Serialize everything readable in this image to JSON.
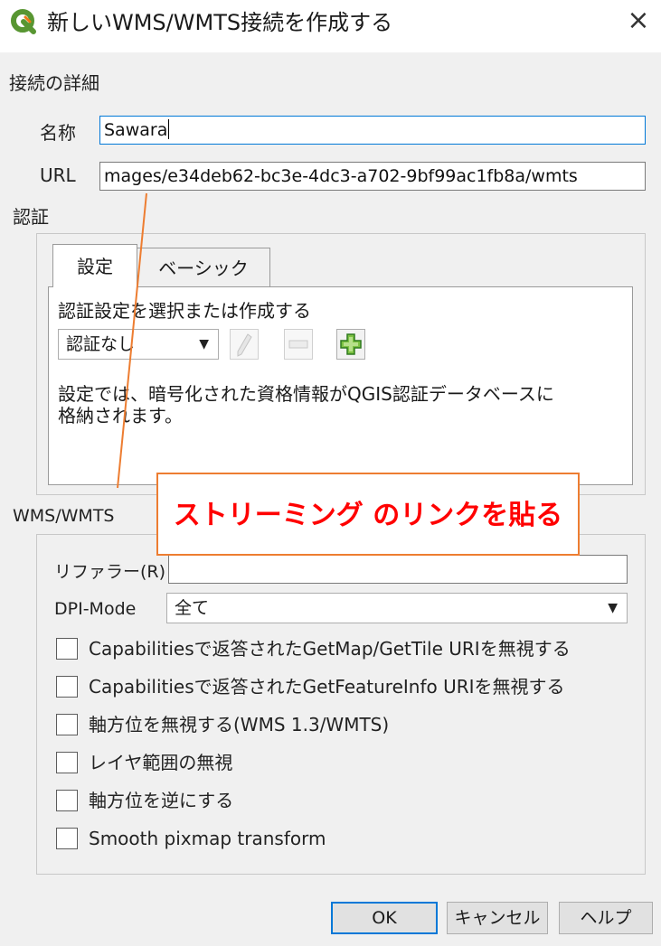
{
  "window": {
    "title": "新しいWMS/WMTS接続を作成する",
    "close_symbol": "×",
    "icon": "qgis-logo-icon"
  },
  "connection_details": {
    "section_label": "接続の詳細",
    "name_label": "名称",
    "name_value": "Sawara",
    "url_label": "URL",
    "url_value": "mages/e34deb62-bc3e-4dc3-a702-9bf99ac1fb8a/wmts"
  },
  "auth": {
    "section_label": "認証",
    "tabs": [
      "設定",
      "ベーシック"
    ],
    "active_tab": "設定",
    "select_label": "認証設定を選択または作成する",
    "config_value": "認証なし",
    "info_line1": "設定では、暗号化された資格情報がQGIS認証データベースに",
    "info_line2": "格納されます。",
    "buttons": [
      "edit-pencil-icon",
      "remove-minus-icon",
      "add-plus-icon"
    ]
  },
  "wms": {
    "section_label": "WMS/WMTS",
    "referer_label": "リファラー(R)",
    "referer_value": "",
    "dpi_label": "DPI-Mode",
    "dpi_value": "全て",
    "options": [
      {
        "label": "Capabilitiesで返答されたGetMap/GetTile URIを無視する",
        "checked": false
      },
      {
        "label": "Capabilitiesで返答されたGetFeatureInfo URIを無視する",
        "checked": false
      },
      {
        "label": "軸方位を無視する(WMS 1.3/WMTS)",
        "checked": false
      },
      {
        "label": "レイヤ範囲の無視",
        "checked": false
      },
      {
        "label": "軸方位を逆にする",
        "checked": false
      },
      {
        "label": "Smooth pixmap transform",
        "checked": false
      }
    ]
  },
  "footer": {
    "ok": "OK",
    "cancel": "キャンセル",
    "help": "ヘルプ"
  },
  "annotation": {
    "callout_text": "ストリーミング のリンクを貼る",
    "border_color": "#ed7d31",
    "text_color": "#ff0000"
  }
}
